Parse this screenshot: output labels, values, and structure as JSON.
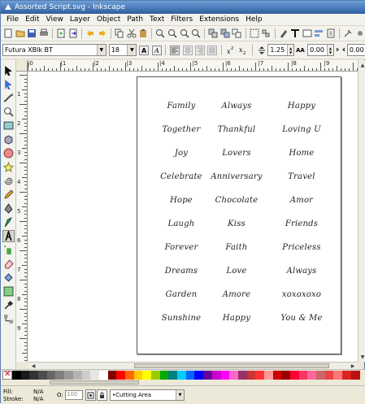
{
  "window": {
    "title": "Assorted Script.svg - Inkscape"
  },
  "menu": [
    "File",
    "Edit",
    "View",
    "Layer",
    "Object",
    "Path",
    "Text",
    "Filters",
    "Extensions",
    "Help"
  ],
  "text_toolbar": {
    "font_family": "Futura XBlk BT",
    "font_size": "18",
    "line_spacing": "1.25",
    "letter_spacing": "0.00",
    "word_spacing": "0.00"
  },
  "ruler": {
    "h_labels": [
      "|0",
      "|1",
      "|2",
      "|3",
      "|4",
      "|5",
      "|6",
      "|7",
      "|8",
      "|9"
    ],
    "v_labels": [
      "1",
      "2",
      "3",
      "4",
      "5",
      "6",
      "7",
      "8",
      "9"
    ]
  },
  "words": [
    [
      "Family",
      "Always",
      "Happy"
    ],
    [
      "Together",
      "Thankful",
      "Loving U"
    ],
    [
      "Joy",
      "Lovers",
      "Home"
    ],
    [
      "Celebrate",
      "Anniversary",
      "Travel"
    ],
    [
      "Hope",
      "Chocolate",
      "Amor"
    ],
    [
      "Laugh",
      "Kiss",
      "Friends"
    ],
    [
      "Forever",
      "Faith",
      "Priceless"
    ],
    [
      "Dreams",
      "Love",
      "Always"
    ],
    [
      "Garden",
      "Amore",
      "xoxoxoxo"
    ],
    [
      "Sunshine",
      "Happy",
      "You & Me"
    ]
  ],
  "palette": [
    "#000000",
    "#1a1a1a",
    "#333333",
    "#4d4d4d",
    "#666666",
    "#808080",
    "#999999",
    "#b3b3b3",
    "#cccccc",
    "#e6e6e6",
    "#ffffff",
    "#800000",
    "#ff0000",
    "#ff6600",
    "#ffcc00",
    "#ffff00",
    "#99cc00",
    "#00aa00",
    "#008080",
    "#00ccff",
    "#0066ff",
    "#0000ff",
    "#660099",
    "#cc00cc",
    "#ff00ff",
    "#ff66cc",
    "#993366",
    "#cc3333",
    "#ff3333",
    "#ff9999",
    "#cc0000",
    "#990000",
    "#ff0033",
    "#ff3366",
    "#ff6699",
    "#cc6666",
    "#ee4444",
    "#ff7777",
    "#dd2222",
    "#bb1111"
  ],
  "status": {
    "fill_label": "Fill:",
    "fill_value": "N/A",
    "stroke_label": "Stroke:",
    "stroke_value": "N/A",
    "opacity_label": "O:",
    "opacity_value": "100",
    "layer_name": "•Cutting Area"
  }
}
